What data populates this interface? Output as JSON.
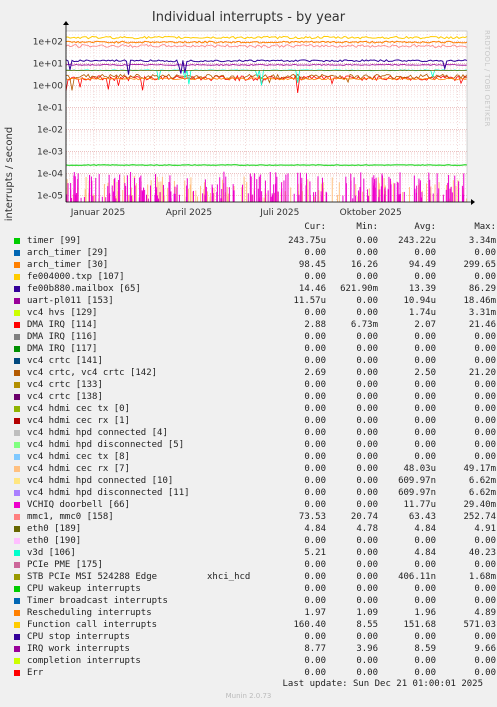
{
  "chart_data": {
    "type": "line",
    "title": "Individual interrupts - by year",
    "ylabel": "interrupts / second",
    "y_scale": "log",
    "ylim": [
      5e-06,
      300
    ],
    "y_ticks": [
      "1e+02",
      "1e+01",
      "1e+00",
      "1e-01",
      "1e-02",
      "1e-03",
      "1e-04",
      "1e-05"
    ],
    "x_ticks": [
      "Januar 2025",
      "April 2025",
      "Juli 2025",
      "Oktober 2025"
    ],
    "grid": true,
    "legend_columns": [
      "Cur:",
      "Min:",
      "Avg:",
      "Max:"
    ],
    "series": [
      {
        "name": "timer [99]",
        "color": "#00cc00",
        "cur": "243.75u",
        "min": "0.00",
        "avg": "243.22u",
        "max": "3.34m"
      },
      {
        "name": "arch_timer [29]",
        "color": "#0066b3",
        "cur": "0.00",
        "min": "0.00",
        "avg": "0.00",
        "max": "0.00"
      },
      {
        "name": "arch_timer [30]",
        "color": "#ff8000",
        "cur": "98.45",
        "min": "16.26",
        "avg": "94.49",
        "max": "299.65"
      },
      {
        "name": "fe004000.txp [107]",
        "color": "#ffcc00",
        "cur": "0.00",
        "min": "0.00",
        "avg": "0.00",
        "max": "0.00"
      },
      {
        "name": "fe00b880.mailbox [65]",
        "color": "#330099",
        "cur": "14.46",
        "min": "621.90m",
        "avg": "13.39",
        "max": "86.29"
      },
      {
        "name": "uart-pl011 [153]",
        "color": "#990099",
        "cur": "11.57u",
        "min": "0.00",
        "avg": "10.94u",
        "max": "18.46m"
      },
      {
        "name": "vc4 hvs [129]",
        "color": "#ccff00",
        "cur": "0.00",
        "min": "0.00",
        "avg": "1.74u",
        "max": "3.31m"
      },
      {
        "name": "DMA IRQ [114]",
        "color": "#ff0000",
        "cur": "2.88",
        "min": "6.73m",
        "avg": "2.07",
        "max": "21.46"
      },
      {
        "name": "DMA IRQ [116]",
        "color": "#808080",
        "cur": "0.00",
        "min": "0.00",
        "avg": "0.00",
        "max": "0.00"
      },
      {
        "name": "DMA IRQ [117]",
        "color": "#008f00",
        "cur": "0.00",
        "min": "0.00",
        "avg": "0.00",
        "max": "0.00"
      },
      {
        "name": "vc4 crtc [141]",
        "color": "#00487d",
        "cur": "0.00",
        "min": "0.00",
        "avg": "0.00",
        "max": "0.00"
      },
      {
        "name": "vc4 crtc, vc4 crtc [142]",
        "color": "#b35a00",
        "cur": "2.69",
        "min": "0.00",
        "avg": "2.50",
        "max": "21.20"
      },
      {
        "name": "vc4 crtc [133]",
        "color": "#b38f00",
        "cur": "0.00",
        "min": "0.00",
        "avg": "0.00",
        "max": "0.00"
      },
      {
        "name": "vc4 crtc [138]",
        "color": "#6b006b",
        "cur": "0.00",
        "min": "0.00",
        "avg": "0.00",
        "max": "0.00"
      },
      {
        "name": "vc4 hdmi cec tx [0]",
        "color": "#8fb300",
        "cur": "0.00",
        "min": "0.00",
        "avg": "0.00",
        "max": "0.00"
      },
      {
        "name": "vc4 hdmi cec rx [1]",
        "color": "#b30000",
        "cur": "0.00",
        "min": "0.00",
        "avg": "0.00",
        "max": "0.00"
      },
      {
        "name": "vc4 hdmi hpd connected [4]",
        "color": "#bebebe",
        "cur": "0.00",
        "min": "0.00",
        "avg": "0.00",
        "max": "0.00"
      },
      {
        "name": "vc4 hdmi hpd disconnected [5]",
        "color": "#80ff80",
        "cur": "0.00",
        "min": "0.00",
        "avg": "0.00",
        "max": "0.00"
      },
      {
        "name": "vc4 hdmi cec tx [8]",
        "color": "#80c9ff",
        "cur": "0.00",
        "min": "0.00",
        "avg": "0.00",
        "max": "0.00"
      },
      {
        "name": "vc4 hdmi cec rx [7]",
        "color": "#ffc080",
        "cur": "0.00",
        "min": "0.00",
        "avg": "48.03u",
        "max": "49.17m"
      },
      {
        "name": "vc4 hdmi hpd connected [10]",
        "color": "#ffe680",
        "cur": "0.00",
        "min": "0.00",
        "avg": "609.97n",
        "max": "6.62m"
      },
      {
        "name": "vc4 hdmi hpd disconnected [11]",
        "color": "#aa80ff",
        "cur": "0.00",
        "min": "0.00",
        "avg": "609.97n",
        "max": "6.62m"
      },
      {
        "name": "VCHIQ doorbell [66]",
        "color": "#ee00cc",
        "cur": "0.00",
        "min": "0.00",
        "avg": "11.77u",
        "max": "29.40m"
      },
      {
        "name": "mmc1, mmc0 [158]",
        "color": "#ff8080",
        "cur": "73.53",
        "min": "20.74",
        "avg": "63.43",
        "max": "252.74"
      },
      {
        "name": "eth0 [189]",
        "color": "#666600",
        "cur": "4.84",
        "min": "4.78",
        "avg": "4.84",
        "max": "4.91"
      },
      {
        "name": "eth0 [190]",
        "color": "#ffbfff",
        "cur": "0.00",
        "min": "0.00",
        "avg": "0.00",
        "max": "0.00"
      },
      {
        "name": "v3d [106]",
        "color": "#00ffcc",
        "cur": "5.21",
        "min": "0.00",
        "avg": "4.84",
        "max": "40.23"
      },
      {
        "name": "PCIe PME [175]",
        "color": "#cc6699",
        "cur": "0.00",
        "min": "0.00",
        "avg": "0.00",
        "max": "0.00"
      },
      {
        "name": "STB PCIe MSI 524288 Edge",
        "extra": "xhci_hcd",
        "color": "#999900",
        "cur": "0.00",
        "min": "0.00",
        "avg": "406.11n",
        "max": "1.68m"
      },
      {
        "name": "CPU wakeup interrupts",
        "color": "#00cc00",
        "cur": "0.00",
        "min": "0.00",
        "avg": "0.00",
        "max": "0.00"
      },
      {
        "name": "Timer broadcast interrupts",
        "color": "#0066b3",
        "cur": "0.00",
        "min": "0.00",
        "avg": "0.00",
        "max": "0.00"
      },
      {
        "name": "Rescheduling interrupts",
        "color": "#ff8000",
        "cur": "1.97",
        "min": "1.09",
        "avg": "1.96",
        "max": "4.89"
      },
      {
        "name": "Function call interrupts",
        "color": "#ffcc00",
        "cur": "160.40",
        "min": "8.55",
        "avg": "151.68",
        "max": "571.03"
      },
      {
        "name": "CPU stop interrupts",
        "color": "#330099",
        "cur": "0.00",
        "min": "0.00",
        "avg": "0.00",
        "max": "0.00"
      },
      {
        "name": "IRQ work interrupts",
        "color": "#990099",
        "cur": "8.77",
        "min": "3.96",
        "avg": "8.59",
        "max": "9.66"
      },
      {
        "name": "completion interrupts",
        "color": "#ccff00",
        "cur": "0.00",
        "min": "0.00",
        "avg": "0.00",
        "max": "0.00"
      },
      {
        "name": "Err",
        "color": "#ff0000",
        "cur": "0.00",
        "min": "0.00",
        "avg": "0.00",
        "max": "0.00"
      }
    ]
  },
  "watermark": "RRDTOOL / TOBI OETIKER",
  "footer": {
    "last_update": "Last update: Sun Dec 21 01:00:01 2025",
    "version": "Munin 2.0.73"
  }
}
